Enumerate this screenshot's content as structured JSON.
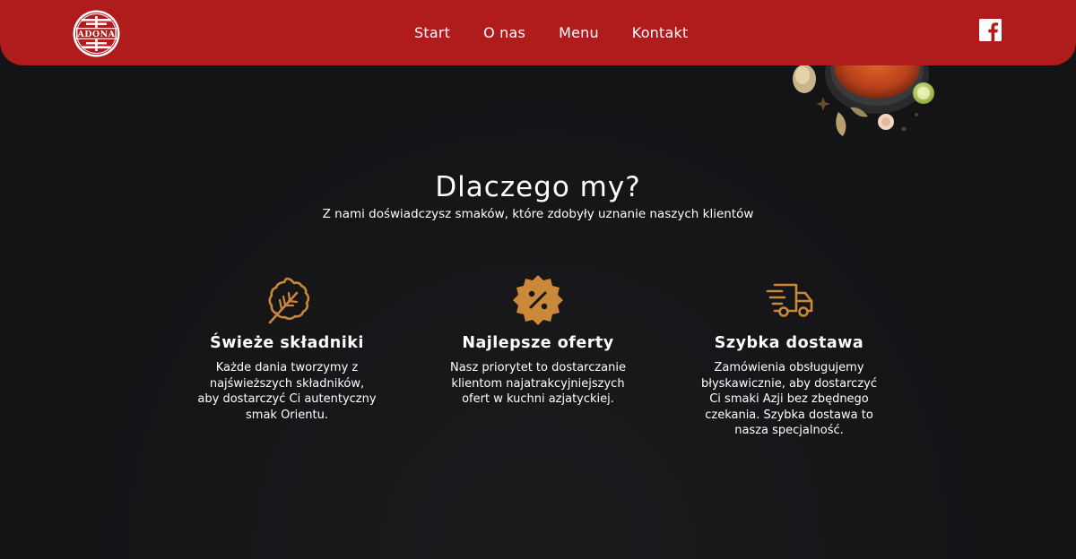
{
  "header": {
    "logo_text": "ADONA",
    "nav": [
      "Start",
      "O nas",
      "Menu",
      "Kontakt"
    ],
    "social_icon": "facebook-icon"
  },
  "hero": {
    "title": "Dlaczego my?",
    "subtitle": "Z nami doświadczysz smaków, które zdobyły uznanie naszych klientów"
  },
  "features": [
    {
      "icon": "leaf-icon",
      "title": "Świeże składniki",
      "description": "Każde dania tworzymy z najświeższych składników, aby dostarczyć Ci autentyczny smak Orientu."
    },
    {
      "icon": "discount-badge-icon",
      "title": "Najlepsze oferty",
      "description": "Nasz priorytet to dostarczanie klientom najatrakcyjniejszych ofert w kuchni azjatyckiej."
    },
    {
      "icon": "delivery-truck-icon",
      "title": "Szybka dostawa",
      "description": "Zamówienia obsługujemy błyskawicznie, aby dostarczyć Ci smaki Azji bez zbędnego czekania. Szybka dostawa to nasza specjalność."
    }
  ],
  "colors": {
    "header_red": "#b01c1c",
    "background": "#141417",
    "accent_gold": "#c9883a",
    "text": "#ffffff"
  }
}
